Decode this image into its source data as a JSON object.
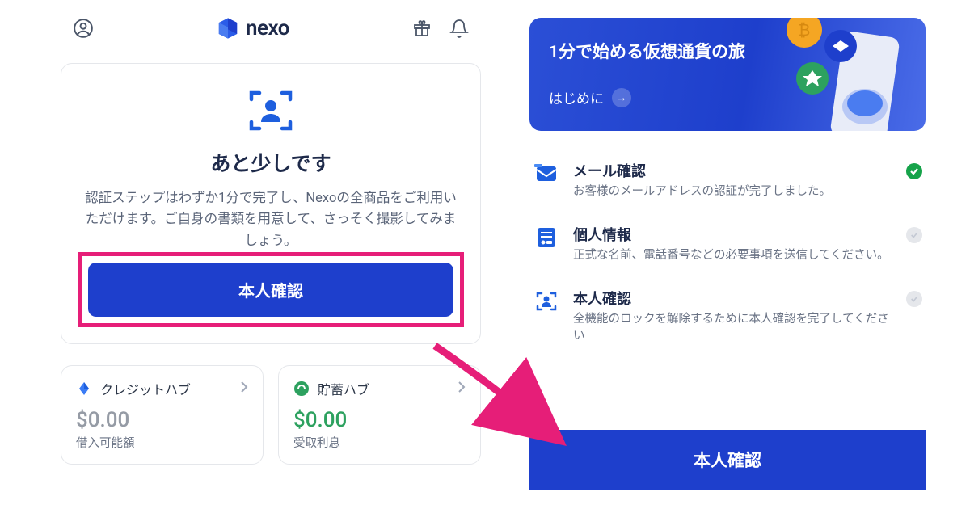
{
  "brand": {
    "name": "nexo"
  },
  "left": {
    "card": {
      "title": "あと少しです",
      "description": "認証ステップはわずか1分で完了し、Nexoの全商品をご利用いただけます。ご自身の書類を用意して、さっそく撮影してみましょう。",
      "button": "本人確認"
    },
    "hubs": [
      {
        "name": "クレジットハブ",
        "value": "$0.00",
        "label": "借入可能額",
        "valueColor": "gray"
      },
      {
        "name": "貯蓄ハブ",
        "value": "$0.00",
        "label": "受取利息",
        "valueColor": "green"
      }
    ]
  },
  "right": {
    "banner": {
      "title": "1分で始める仮想通貨の旅",
      "cta": "はじめに"
    },
    "steps": [
      {
        "title": "メール確認",
        "desc": "お客様のメールアドレスの認証が完了しました。",
        "status": "done",
        "icon": "mail"
      },
      {
        "title": "個人情報",
        "desc": "正式な名前、電話番号などの必要事項を送信してください。",
        "status": "pending",
        "icon": "form"
      },
      {
        "title": "本人確認",
        "desc": "全機能のロックを解除するために本人確認を完了してください",
        "status": "pending",
        "icon": "scan"
      }
    ],
    "bottomButton": "本人確認"
  },
  "colors": {
    "primary": "#1e3fcc",
    "accent": "#e61e78",
    "success": "#16a34a"
  }
}
